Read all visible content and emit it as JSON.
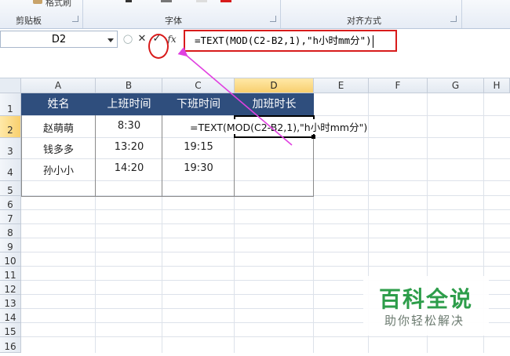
{
  "ribbon": {
    "clipboard_label": "剪贴板",
    "font_label": "字体",
    "align_label": "对齐方式",
    "format_painter": "格式刷"
  },
  "formula_bar": {
    "name_box": "D2",
    "cancel_symbol": "✕",
    "enter_symbol": "✓",
    "fx_symbol": "fx",
    "formula_text": "=TEXT(MOD(C2-B2,1),\"h小时mm分\")"
  },
  "grid": {
    "columns": [
      "A",
      "B",
      "C",
      "D",
      "E",
      "F",
      "G",
      "H"
    ],
    "rows": [
      "1",
      "2",
      "3",
      "4",
      "5",
      "6",
      "7",
      "8",
      "9",
      "10",
      "11",
      "12",
      "13",
      "14",
      "15",
      "16"
    ],
    "headers": [
      "姓名",
      "上班时间",
      "下班时间",
      "加班时长"
    ],
    "data": [
      [
        "赵萌萌",
        "8:30",
        ""
      ],
      [
        "钱多多",
        "13:20",
        "19:15"
      ],
      [
        "孙小小",
        "14:20",
        "19:30"
      ]
    ],
    "editing_formula": "=TEXT(MOD(C2-B2,1),\"h小时mm分\")"
  },
  "colors": {
    "header_fill": "#2f4e7d",
    "annotation_red": "#d81b1b",
    "arrow_magenta": "#e040e0",
    "watermark_green": "#2d9d4a"
  },
  "watermark": {
    "title": "百科全说",
    "subtitle": "助你轻松解决"
  }
}
